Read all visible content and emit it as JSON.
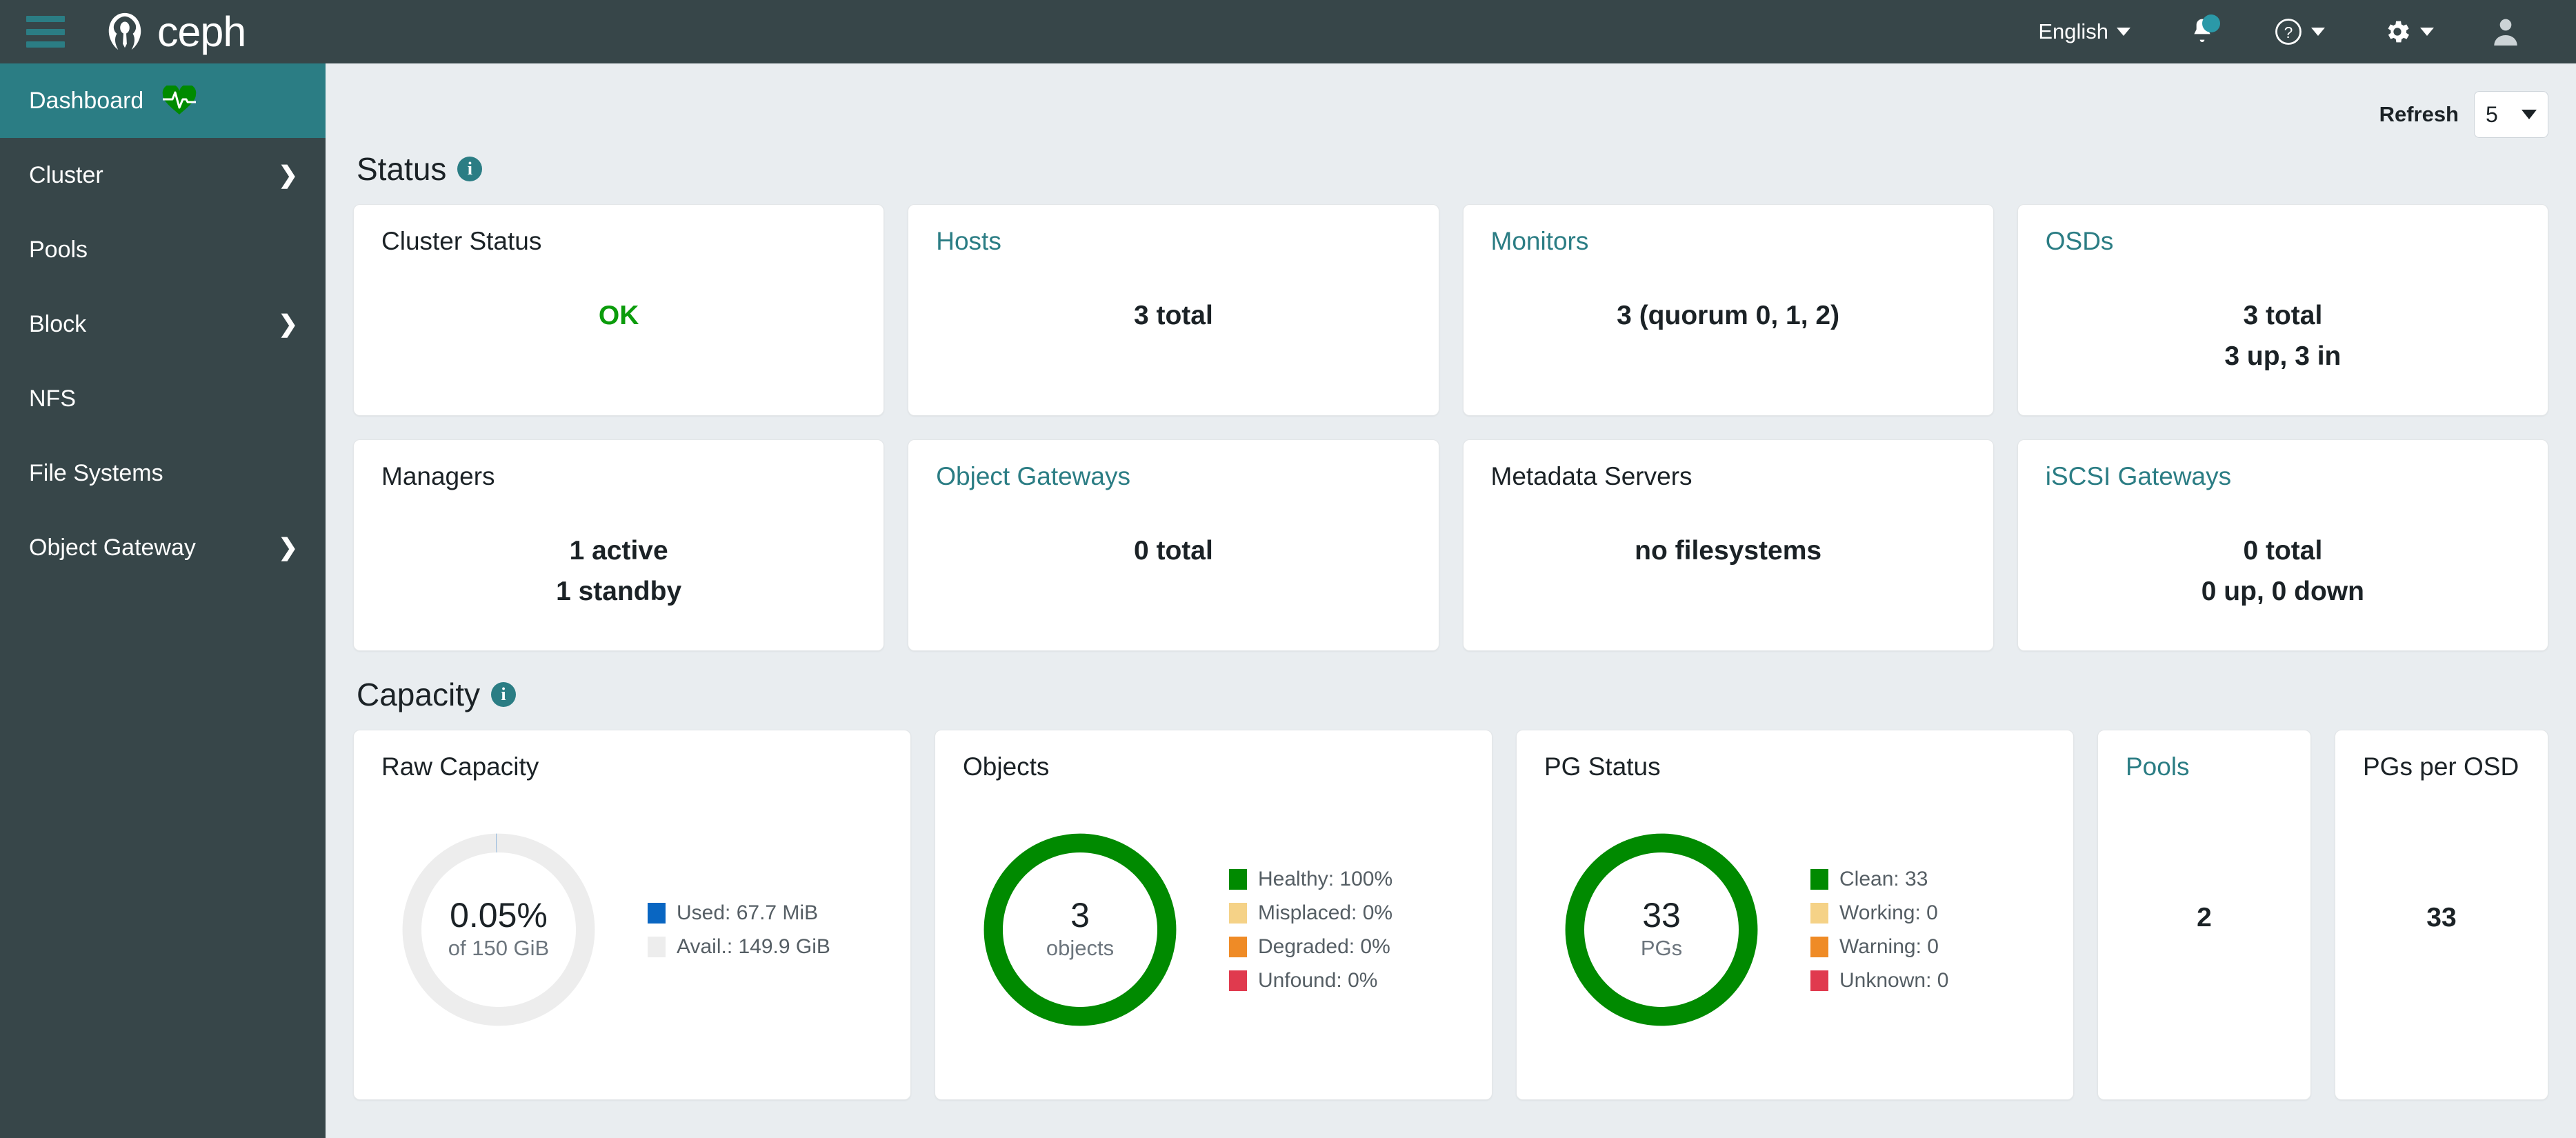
{
  "navbar": {
    "brand": "ceph",
    "hamburger_icon": "hamburger-menu-icon",
    "logo_icon": "ceph-logo-icon",
    "language": "English",
    "notifications_icon": "bell-icon",
    "help_icon": "help-circle-icon",
    "settings_icon": "gear-icon",
    "user_icon": "user-avatar-icon"
  },
  "sidebar": {
    "items": [
      {
        "label": "Dashboard",
        "active": true,
        "has_chevron": false,
        "icon": "heartbeat-icon"
      },
      {
        "label": "Cluster",
        "active": false,
        "has_chevron": true
      },
      {
        "label": "Pools",
        "active": false,
        "has_chevron": false
      },
      {
        "label": "Block",
        "active": false,
        "has_chevron": true
      },
      {
        "label": "NFS",
        "active": false,
        "has_chevron": false
      },
      {
        "label": "File Systems",
        "active": false,
        "has_chevron": false
      },
      {
        "label": "Object Gateway",
        "active": false,
        "has_chevron": true
      }
    ]
  },
  "toolbar": {
    "refresh_label": "Refresh",
    "refresh_value": "5"
  },
  "status_section": {
    "title": "Status",
    "info_icon": "info-icon",
    "cards": [
      {
        "title": "Cluster Status",
        "is_link": false,
        "values": [
          "OK"
        ],
        "value_color": "ok"
      },
      {
        "title": "Hosts",
        "is_link": true,
        "values": [
          "3 total"
        ]
      },
      {
        "title": "Monitors",
        "is_link": true,
        "values": [
          "3 (quorum 0, 1, 2)"
        ]
      },
      {
        "title": "OSDs",
        "is_link": true,
        "values": [
          "3 total",
          "3 up, 3 in"
        ]
      },
      {
        "title": "Managers",
        "is_link": false,
        "values": [
          "1 active",
          "1 standby"
        ]
      },
      {
        "title": "Object Gateways",
        "is_link": true,
        "values": [
          "0 total"
        ]
      },
      {
        "title": "Metadata Servers",
        "is_link": false,
        "values": [
          "no filesystems"
        ]
      },
      {
        "title": "iSCSI Gateways",
        "is_link": true,
        "values": [
          "0 total",
          "0 up, 0 down"
        ]
      }
    ]
  },
  "capacity_section": {
    "title": "Capacity",
    "info_icon": "info-icon",
    "raw_capacity": {
      "title": "Raw Capacity",
      "is_link": false,
      "center_main": "0.05%",
      "center_sub": "of 150 GiB",
      "legend": [
        {
          "label": "Used: 67.7 MiB",
          "color": "#0966c2"
        },
        {
          "label": "Avail.: 149.9 GiB",
          "color": "#ededed"
        }
      ]
    },
    "objects": {
      "title": "Objects",
      "is_link": false,
      "center_main": "3",
      "center_sub": "objects",
      "legend": [
        {
          "label": "Healthy: 100%",
          "color": "#008a00"
        },
        {
          "label": "Misplaced: 0%",
          "color": "#f5d287"
        },
        {
          "label": "Degraded: 0%",
          "color": "#ef8b26"
        },
        {
          "label": "Unfound: 0%",
          "color": "#e03a4e"
        }
      ]
    },
    "pg_status": {
      "title": "PG Status",
      "is_link": false,
      "center_main": "33",
      "center_sub": "PGs",
      "legend": [
        {
          "label": "Clean: 33",
          "color": "#008a00"
        },
        {
          "label": "Working: 0",
          "color": "#f5d287"
        },
        {
          "label": "Warning: 0",
          "color": "#ef8b26"
        },
        {
          "label": "Unknown: 0",
          "color": "#e03a4e"
        }
      ]
    },
    "pools": {
      "title": "Pools",
      "is_link": true,
      "value": "2"
    },
    "pgs_per_osd": {
      "title": "PGs per OSD",
      "is_link": false,
      "value": "33"
    }
  },
  "chart_data": [
    {
      "type": "pie",
      "title": "Raw Capacity",
      "labels": [
        "Used",
        "Avail."
      ],
      "values": [
        0.05,
        99.95
      ],
      "value_labels": [
        "67.7 MiB",
        "149.9 GiB"
      ],
      "colors": [
        "#0966c2",
        "#ededed"
      ],
      "total": "150 GiB",
      "center_text": "0.05%",
      "legend_position": "right"
    },
    {
      "type": "pie",
      "title": "Objects",
      "labels": [
        "Healthy",
        "Misplaced",
        "Degraded",
        "Unfound"
      ],
      "values": [
        100,
        0,
        0,
        0
      ],
      "colors": [
        "#008a00",
        "#f5d287",
        "#ef8b26",
        "#e03a4e"
      ],
      "center_text": "3 objects",
      "legend_position": "right"
    },
    {
      "type": "pie",
      "title": "PG Status",
      "labels": [
        "Clean",
        "Working",
        "Warning",
        "Unknown"
      ],
      "values": [
        33,
        0,
        0,
        0
      ],
      "colors": [
        "#008a00",
        "#f5d287",
        "#ef8b26",
        "#e03a4e"
      ],
      "center_text": "33 PGs",
      "legend_position": "right"
    }
  ]
}
